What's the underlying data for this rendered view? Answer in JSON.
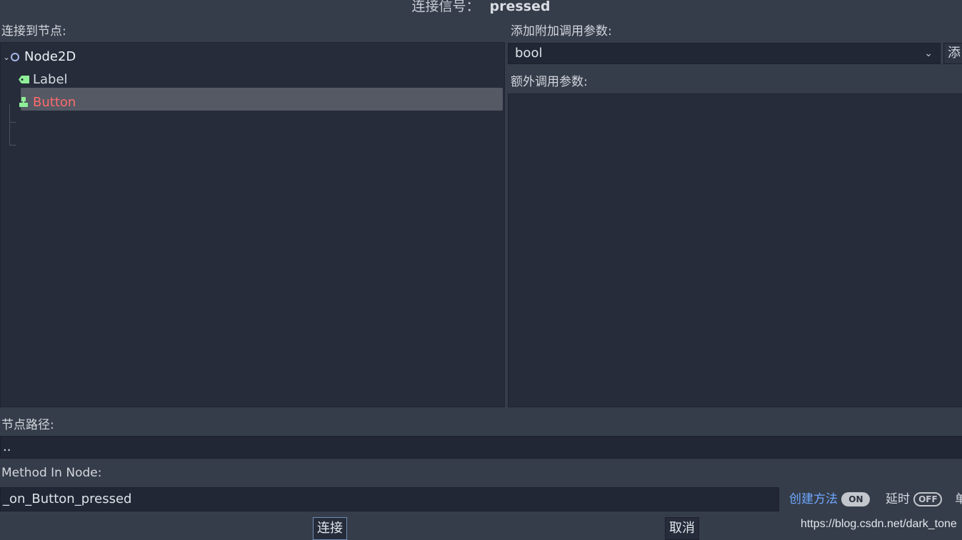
{
  "dialog": {
    "title_label": "连接信号：",
    "signal_name": "pressed"
  },
  "left": {
    "connect_to_label": "连接到节点:",
    "tree": [
      {
        "name": "Node2D",
        "icon": "circle-icon",
        "selected": true
      },
      {
        "name": "Label",
        "icon": "label-tag-icon",
        "color": "#d6dbe3"
      },
      {
        "name": "Button",
        "icon": "button-icon",
        "color": "#ff6b6b"
      }
    ]
  },
  "right": {
    "add_extra_args_label": "添加附加调用参数:",
    "type_select_value": "bool",
    "add_button_label": "添",
    "extra_args_label": "额外调用参数:"
  },
  "node_path": {
    "label": "节点路径:",
    "value": ".."
  },
  "method": {
    "label": "Method In Node:",
    "value": "_on_Button_pressed",
    "create_method_label": "创建方法",
    "create_method_state": "ON",
    "deferred_label": "延时",
    "deferred_state": "OFF",
    "oneshot_label": "单"
  },
  "buttons": {
    "connect": "连接",
    "cancel": "取消"
  },
  "watermark": "https://blog.csdn.net/dark_tone",
  "colors": {
    "accent_link": "#6ea8ff",
    "error_red": "#ff6b6b",
    "node_icon_green": "#8eef97",
    "background": "#363d4a",
    "panel": "#262c3a"
  }
}
